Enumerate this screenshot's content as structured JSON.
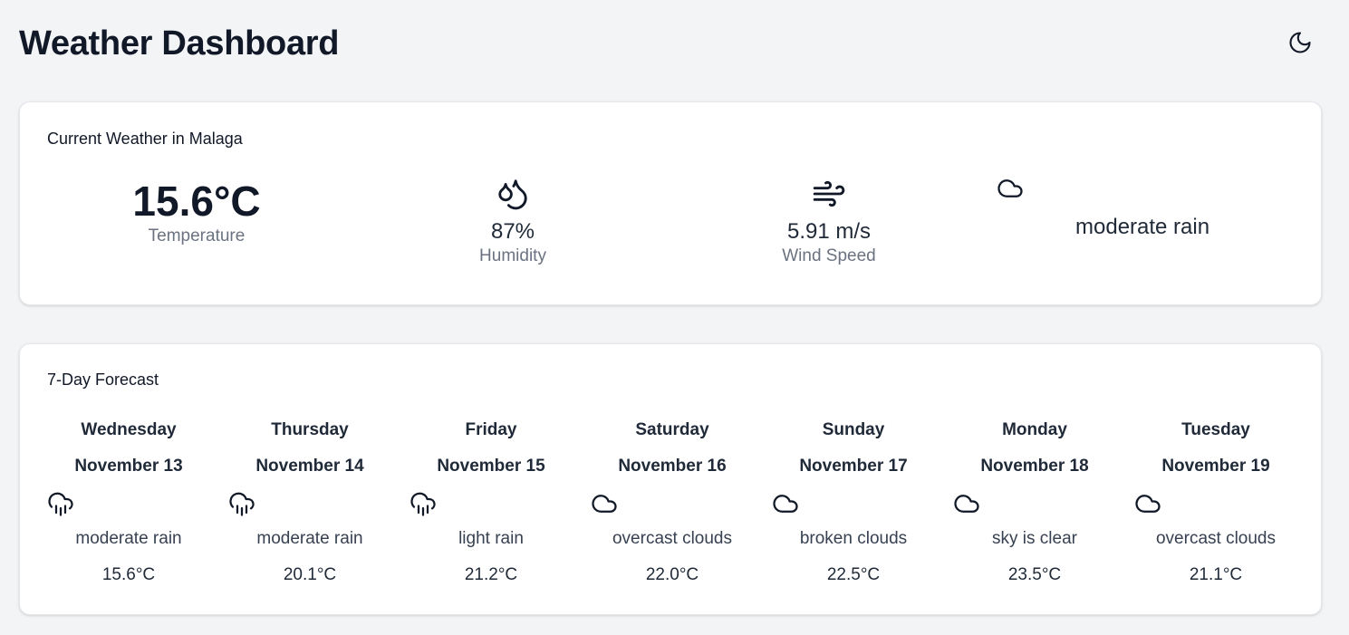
{
  "header": {
    "title": "Weather Dashboard",
    "theme_toggle_icon": "moon-icon"
  },
  "current": {
    "title": "Current Weather in Malaga",
    "temperature": {
      "value": "15.6°C",
      "label": "Temperature"
    },
    "humidity": {
      "value": "87%",
      "label": "Humidity",
      "icon": "droplets-icon"
    },
    "wind": {
      "value": "5.91 m/s",
      "label": "Wind Speed",
      "icon": "wind-icon"
    },
    "condition": {
      "text": "moderate rain",
      "icon": "cloud-icon"
    }
  },
  "forecast": {
    "title": "7-Day Forecast",
    "days": [
      {
        "day": "Wednesday",
        "date": "November 13",
        "icon": "cloud-rain-icon",
        "description": "moderate rain",
        "temp": "15.6°C"
      },
      {
        "day": "Thursday",
        "date": "November 14",
        "icon": "cloud-rain-icon",
        "description": "moderate rain",
        "temp": "20.1°C"
      },
      {
        "day": "Friday",
        "date": "November 15",
        "icon": "cloud-rain-icon",
        "description": "light rain",
        "temp": "21.2°C"
      },
      {
        "day": "Saturday",
        "date": "November 16",
        "icon": "cloud-icon",
        "description": "overcast clouds",
        "temp": "22.0°C"
      },
      {
        "day": "Sunday",
        "date": "November 17",
        "icon": "cloud-icon",
        "description": "broken clouds",
        "temp": "22.5°C"
      },
      {
        "day": "Monday",
        "date": "November 18",
        "icon": "cloud-icon",
        "description": "sky is clear",
        "temp": "23.5°C"
      },
      {
        "day": "Tuesday",
        "date": "November 19",
        "icon": "cloud-icon",
        "description": "overcast clouds",
        "temp": "21.1°C"
      }
    ]
  }
}
